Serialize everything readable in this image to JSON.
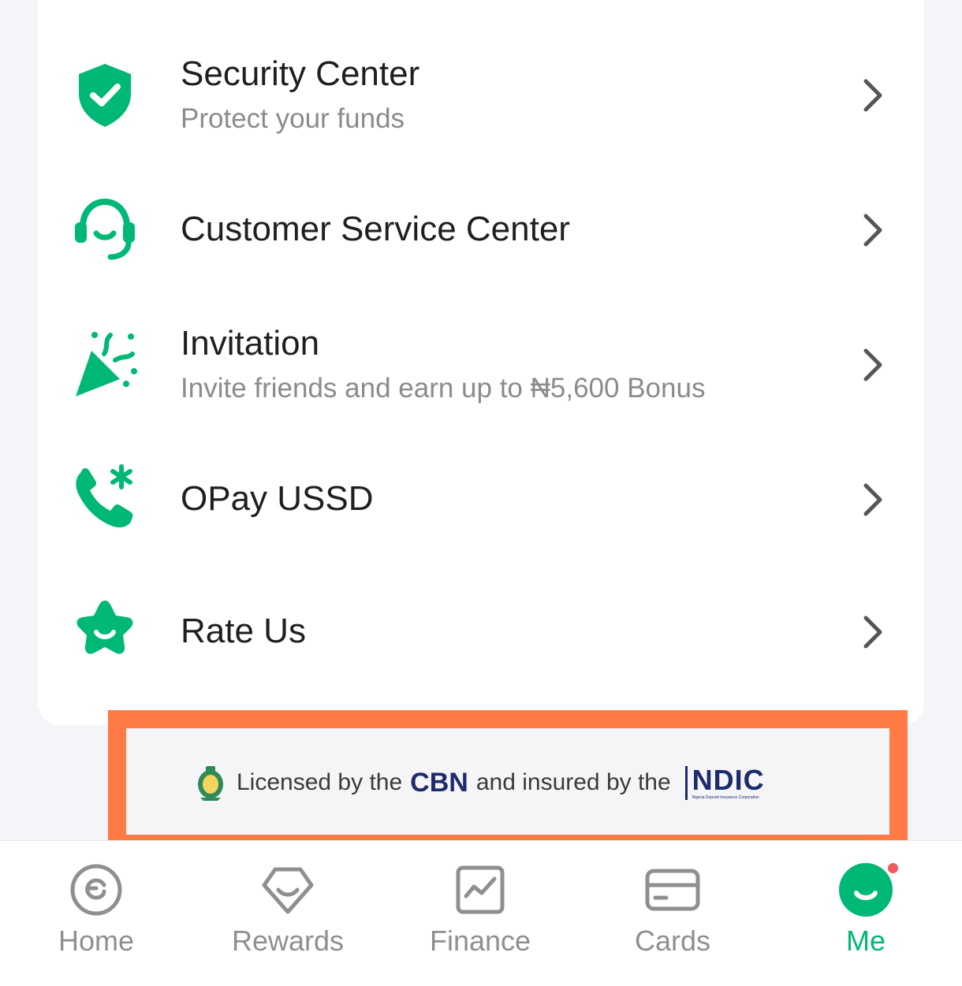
{
  "colors": {
    "accent": "#00b875",
    "title_text": "#1f1f1f",
    "subtitle_text": "#8b8b8b",
    "highlight_border": "#ff7a45",
    "ndic_blue": "#1d2b6e",
    "notification_dot": "#f05a5a"
  },
  "menu": {
    "items": [
      {
        "icon": "shield-check-icon",
        "title": "Security Center",
        "subtitle": "Protect your funds"
      },
      {
        "icon": "headset-icon",
        "title": "Customer Service Center",
        "subtitle": ""
      },
      {
        "icon": "party-popper-icon",
        "title": "Invitation",
        "subtitle": "Invite friends and earn up to ₦5,600 Bonus"
      },
      {
        "icon": "phone-asterisk-icon",
        "title": "OPay USSD",
        "subtitle": ""
      },
      {
        "icon": "smiling-star-icon",
        "title": "Rate Us",
        "subtitle": ""
      }
    ]
  },
  "license": {
    "prefix": "Licensed by the",
    "cbn": "CBN",
    "middle": "and insured by the",
    "ndic": "NDIC",
    "ndic_full": "Nigeria Deposit Insurance Corporation"
  },
  "tabs": [
    {
      "label": "Home",
      "icon": "home-circle-icon",
      "active": false
    },
    {
      "label": "Rewards",
      "icon": "rewards-gem-icon",
      "active": false
    },
    {
      "label": "Finance",
      "icon": "finance-chart-icon",
      "active": false
    },
    {
      "label": "Cards",
      "icon": "card-icon",
      "active": false
    },
    {
      "label": "Me",
      "icon": "me-face-icon",
      "active": true
    }
  ]
}
